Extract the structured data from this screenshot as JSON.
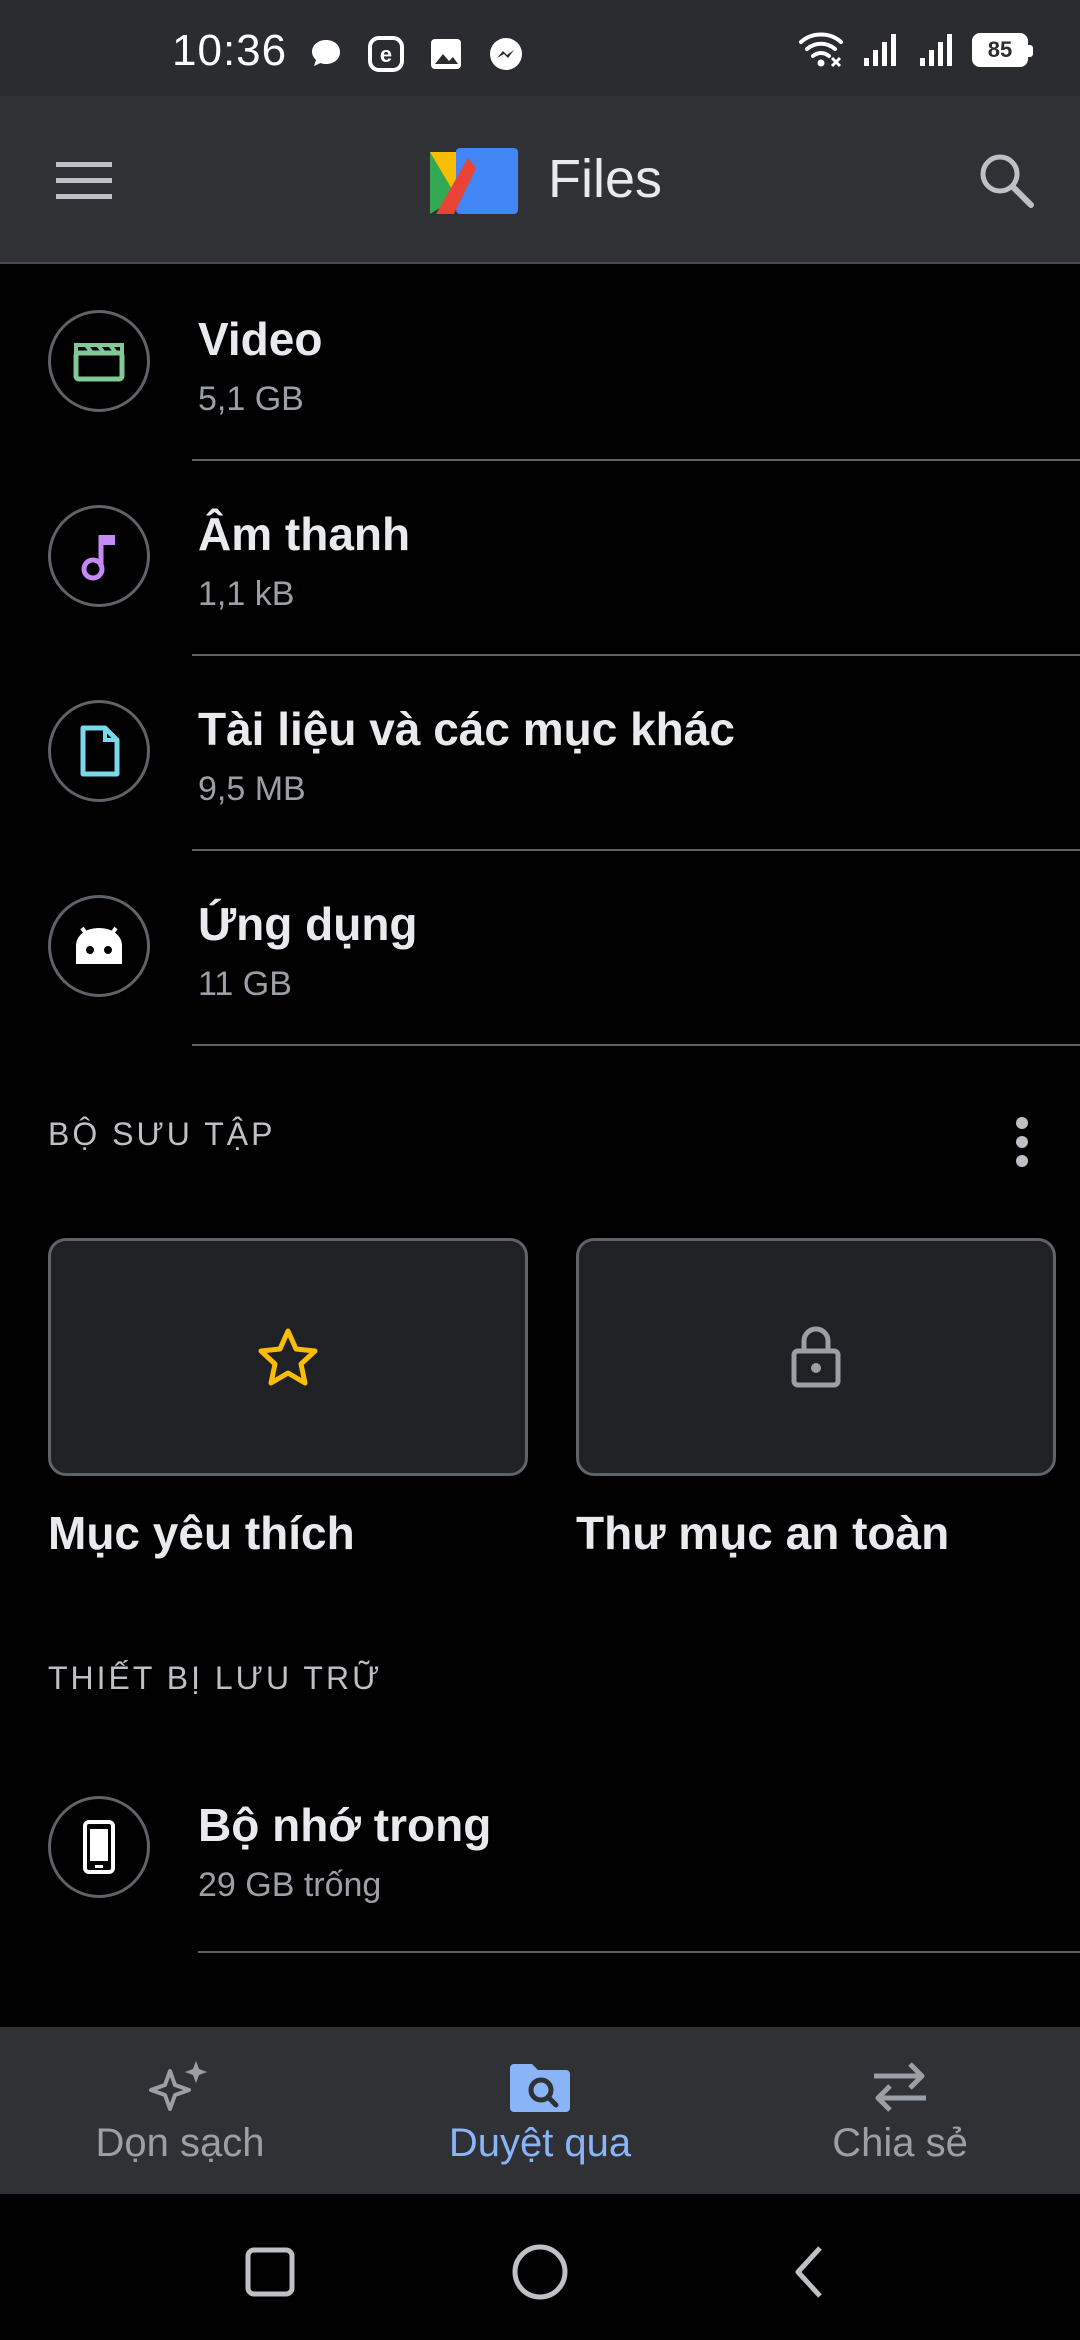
{
  "status_bar": {
    "time": "10:36",
    "battery": "85"
  },
  "app_bar": {
    "title": "Files"
  },
  "categories": [
    {
      "title": "Video",
      "subtitle": "5,1 GB",
      "icon": "video-icon",
      "color": "#81c995"
    },
    {
      "title": "Âm thanh",
      "subtitle": "1,1 kB",
      "icon": "music-note-icon",
      "color": "#c58af9"
    },
    {
      "title": "Tài liệu và các mục khác",
      "subtitle": "9,5 MB",
      "icon": "document-icon",
      "color": "#78d9ec"
    },
    {
      "title": "Ứng dụng",
      "subtitle": "11 GB",
      "icon": "android-icon",
      "color": "#ffffff"
    }
  ],
  "collections": {
    "header": "BỘ SƯU TẬP",
    "favorites_label": "Mục yêu thích",
    "safe_folder_label": "Thư mục an toàn",
    "star_color": "#fbbc04"
  },
  "storage": {
    "header": "THIẾT BỊ LƯU TRỮ",
    "internal_title": "Bộ nhớ trong",
    "internal_subtitle": "29 GB trống"
  },
  "bottom_nav": {
    "clean_label": "Dọn sạch",
    "browse_label": "Duyệt qua",
    "share_label": "Chia sẻ",
    "active_color": "#8ab4f8"
  }
}
